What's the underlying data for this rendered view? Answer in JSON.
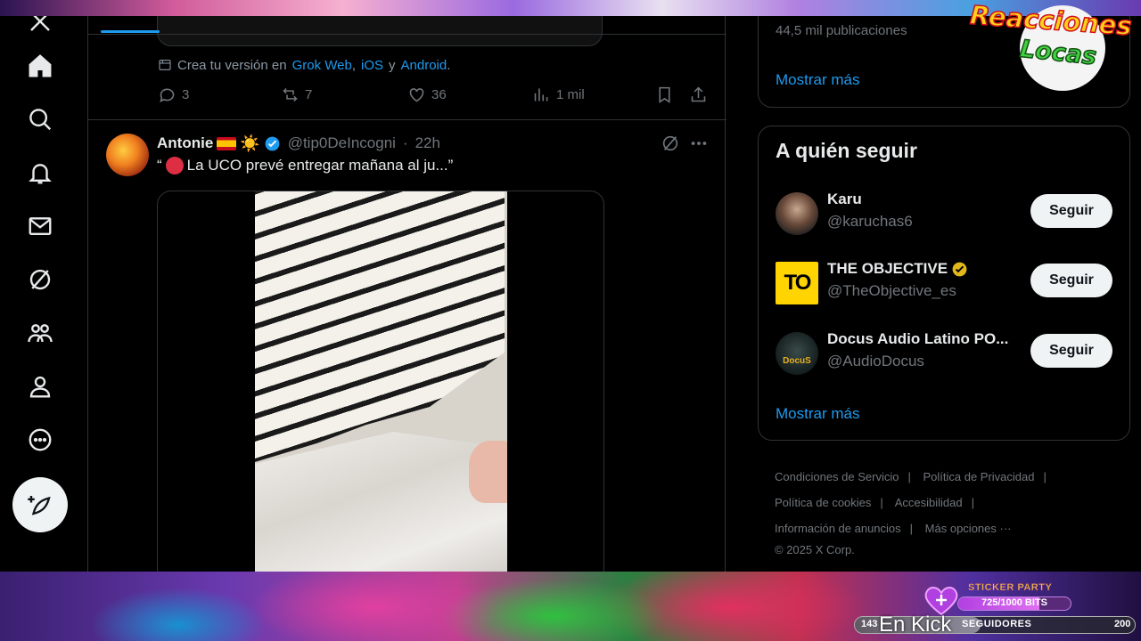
{
  "nav": {
    "items": [
      "x-logo",
      "home",
      "explore",
      "notifications",
      "messages",
      "grok",
      "communities",
      "profile",
      "more"
    ],
    "post_button": "post"
  },
  "prev_tweet": {
    "grok_prefix": "Crea tu versión en",
    "grok_link1": "Grok Web",
    "grok_sep1": ",",
    "grok_link2": "iOS",
    "grok_sep2": "y",
    "grok_link3": "Android",
    "grok_end": ".",
    "replies": "3",
    "reposts": "7",
    "likes": "36",
    "views": "1 mil"
  },
  "tweet": {
    "name": "Antonie",
    "emoji_sun": "☀️",
    "handle": "@tip0DeIncogni",
    "time_sep": "·",
    "time": "22h",
    "quote_open": "“",
    "text": "La UCO prevé entregar mañana al ju...”"
  },
  "right": {
    "pub_count": "44,5 mil publicaciones",
    "show_more_top": "Mostrar más",
    "follow_title": "A quién seguir",
    "accounts": [
      {
        "name": "Karu",
        "handle": "@karuchas6",
        "button": "Seguir"
      },
      {
        "name": "THE OBJECTIVE",
        "handle": "@TheObjective_es",
        "button": "Seguir",
        "avatar_text": "TO"
      },
      {
        "name": "Docus Audio Latino PO...",
        "handle": "@AudioDocus",
        "button": "Seguir",
        "avatar_text": "DocuS"
      }
    ],
    "show_more_follow": "Mostrar más",
    "footer": {
      "terms": "Condiciones de Servicio",
      "privacy": "Política de Privacidad",
      "cookies": "Política de cookies",
      "accessibility": "Accesibilidad",
      "ads": "Información de anuncios",
      "more": "Más opciones ···",
      "copyright": "© 2025 X Corp."
    }
  },
  "overlay": {
    "logo_line1": "Reacciones",
    "logo_line2": "Locas",
    "sticker_title": "STICKER PARTY",
    "sticker_progress": "725/1000 BITS",
    "sticker_fraction": 0.725,
    "kick_left": "143",
    "kick_label": "SEGUIDORES",
    "kick_right": "200",
    "en_kick": "En Kick"
  }
}
